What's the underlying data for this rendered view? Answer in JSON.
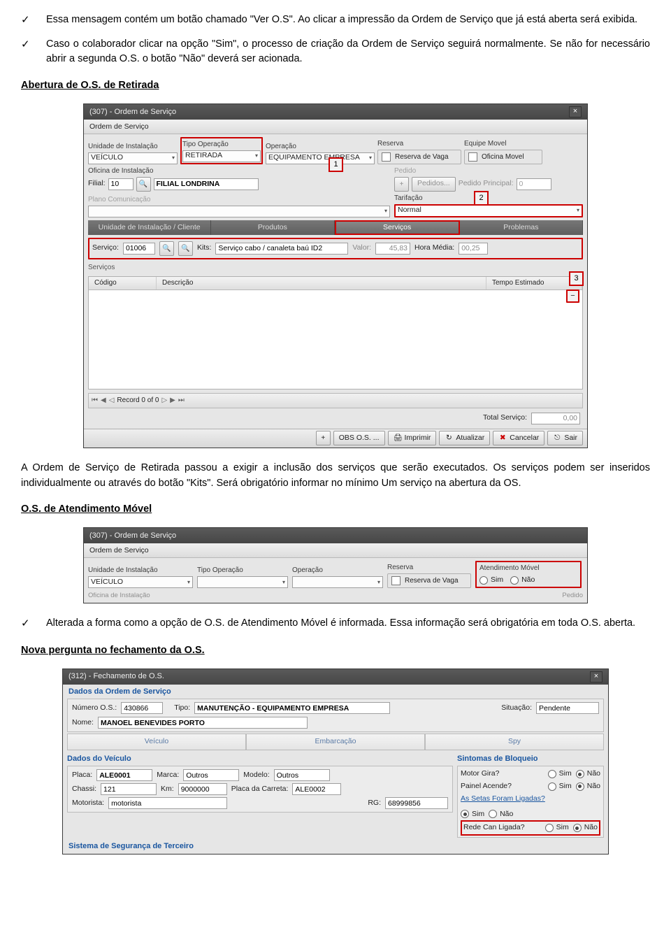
{
  "bullets_top": [
    "Essa mensagem contém um botão chamado \"Ver O.S\". Ao clicar a impressão da Ordem de Serviço que já está aberta será exibida.",
    "Caso o colaborador clicar na opção \"Sim\", o processo de criação da Ordem de Serviço seguirá normalmente. Se não for necessário abrir a segunda O.S. o botão \"Não\" deverá ser acionada."
  ],
  "section1_title": "Abertura de O.S. de Retirada",
  "win1": {
    "title": "(307) - Ordem de Serviço",
    "menu": "Ordem de Serviço",
    "und_instal_lab": "Unidade de Instalação",
    "und_instal": "VEÍCULO",
    "tipo_op_lab": "Tipo Operação",
    "tipo_op": "RETIRADA",
    "operacao_lab": "Operação",
    "operacao": "EQUIPAMENTO EMPRESA",
    "reserva_lab": "Reserva",
    "reserva_chk": "Reserva de Vaga",
    "equipe_lab": "Equipe Movel",
    "equipe_chk": "Oficina Movel",
    "oficina_lab": "Oficina de Instalação",
    "filial_lab": "Filial:",
    "filial_val": "10",
    "filial_nome": "FILIAL LONDRINA",
    "pedido_grp": "Pedido",
    "pedidos_btn": "Pedidos...",
    "pedido_principal_lab": "Pedido Principal:",
    "pedido_principal": "0",
    "plano_grp": "Plano Comunicação",
    "tarifa_lab": "Tarifação",
    "tarifa": "Normal",
    "tabs": [
      "Unidade de Instalação / Cliente",
      "Produtos",
      "Serviços",
      "Problemas"
    ],
    "servico_lab": "Serviço:",
    "servico_cod": "01006",
    "kits": "Kits:",
    "servico_nome": "Serviço cabo / canaleta baú ID2",
    "valor_lab": "Valor:",
    "valor": "45,83",
    "hora_lab": "Hora Média:",
    "hora": "00,25",
    "servicos_grp": "Serviços",
    "col_codigo": "Código",
    "col_desc": "Descrição",
    "col_tempo": "Tempo Estimado",
    "record": "Record 0 of 0",
    "total_lab": "Total Serviço:",
    "total": "0,00",
    "btns": [
      "OBS O.S. ...",
      "Imprimir",
      "Atualizar",
      "Cancelar",
      "Sair"
    ],
    "callouts": [
      "1",
      "2",
      "3"
    ]
  },
  "para1": "A Ordem de Serviço de Retirada passou a exigir a inclusão dos serviços que serão executados. Os serviços podem ser inseridos individualmente ou através do botão \"Kits\". Será obrigatório informar no mínimo Um serviço na abertura da OS.",
  "section2_title": "O.S. de Atendimento Móvel",
  "win2": {
    "title": "(307) - Ordem de Serviço",
    "menu": "Ordem de Serviço",
    "und_instal_lab": "Unidade de Instalação",
    "und_instal": "VEÍCULO",
    "tipo_op_lab": "Tipo Operação",
    "operacao_lab": "Operação",
    "reserva_lab": "Reserva",
    "reserva_chk": "Reserva de Vaga",
    "atend_lab": "Atendimento Móvel",
    "sim": "Sim",
    "nao": "Não",
    "ofic": "Oficina de Instalação",
    "pedido": "Pedido"
  },
  "bullet_mid": "Alterada a forma como a opção de O.S. de Atendimento Móvel é informada. Essa informação será obrigatória em toda O.S. aberta.",
  "section3_title": "Nova pergunta no fechamento da O.S.",
  "win3": {
    "title": "(312) - Fechamento de O.S.",
    "dados": "Dados da Ordem de Serviço",
    "num_lab": "Número O.S.:",
    "num": "430866",
    "tipo_lab": "Tipo:",
    "tipo": "MANUTENÇÃO - EQUIPAMENTO EMPRESA",
    "sit_lab": "Situação:",
    "sit": "Pendente",
    "nome_lab": "Nome:",
    "nome": "MANOEL BENEVIDES PORTO",
    "tabs": [
      "Veículo",
      "Embarcação",
      "Spy"
    ],
    "dados_veic": "Dados do Veículo",
    "sintomas": "Sintomas de Bloqueio",
    "placa_lab": "Placa:",
    "placa": "ALE0001",
    "marca_lab": "Marca:",
    "marca": "Outros",
    "modelo_lab": "Modelo:",
    "modelo": "Outros",
    "chassi_lab": "Chassi:",
    "chassi": "121",
    "km_lab": "Km:",
    "km": "9000000",
    "placac_lab": "Placa da Carreta:",
    "placac": "ALE0002",
    "motor_lab": "Motorista:",
    "motor": "motorista",
    "rg_lab": "RG:",
    "rg": "68999856",
    "q1": "Motor Gira?",
    "q2": "Painel Acende?",
    "q3": "As Setas Foram Ligadas?",
    "q4": "Rede Can Ligada?",
    "sim": "Sim",
    "nao": "Não",
    "sist": "Sistema de Segurança de Terceiro"
  }
}
